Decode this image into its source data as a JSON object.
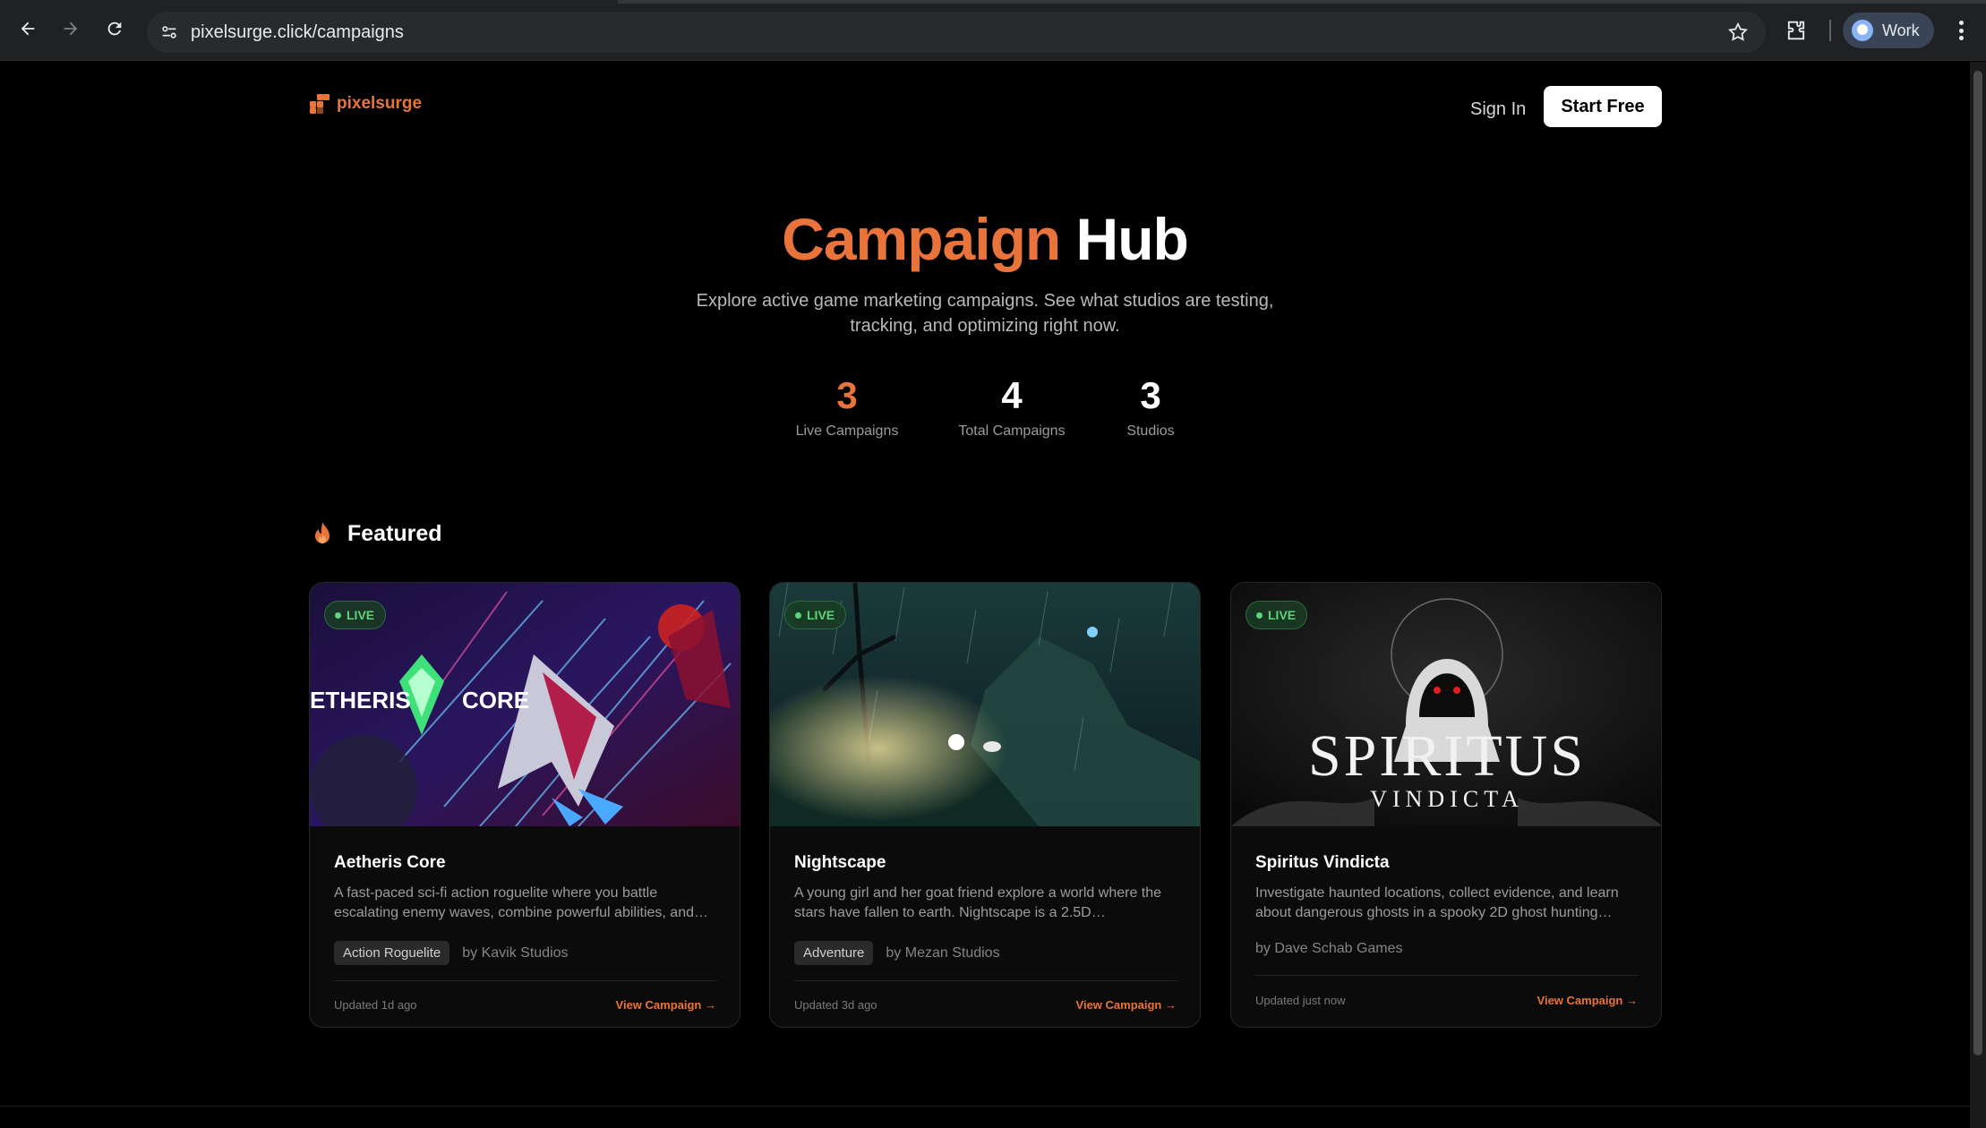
{
  "browser": {
    "url": "pixelsurge.click/campaigns",
    "profile_label": "Work"
  },
  "header": {
    "logo_text": "pixelsurge",
    "sign_in": "Sign In",
    "start_free": "Start Free"
  },
  "hero": {
    "title_accent": "Campaign",
    "title_rest": "Hub",
    "subtitle": "Explore active game marketing campaigns. See what studios are testing, tracking, and optimizing right now."
  },
  "stats": [
    {
      "value": "3",
      "label": "Live Campaigns"
    },
    {
      "value": "4",
      "label": "Total Campaigns"
    },
    {
      "value": "3",
      "label": "Studios"
    }
  ],
  "featured": {
    "heading": "Featured",
    "cards": [
      {
        "badge": "LIVE",
        "image_text": "ETHERIS CORE",
        "title": "Aetheris Core",
        "description": "A fast-paced sci-fi action roguelite where you battle escalating enemy waves, combine powerful abilities, and…",
        "tag": "Action Roguelite",
        "studio": "by Kavik Studios",
        "updated": "Updated 1d ago",
        "view": "View Campaign →"
      },
      {
        "badge": "LIVE",
        "title": "Nightscape",
        "description": "A young girl and her goat friend explore a world where the stars have fallen to earth. Nightscape is a 2.5D…",
        "tag": "Adventure",
        "studio": "by Mezan Studios",
        "updated": "Updated 3d ago",
        "view": "View Campaign →"
      },
      {
        "badge": "LIVE",
        "image_title": "SPIRITUS",
        "image_subtitle": "VINDICTA",
        "title": "Spiritus Vindicta",
        "description": "Investigate haunted locations, collect evidence, and learn about dangerous ghosts in a spooky 2D ghost hunting…",
        "studio": "by Dave Schab Games",
        "updated": "Updated just now",
        "view": "View Campaign →"
      }
    ]
  },
  "colors": {
    "accent": "#e8743b",
    "live_green": "#5fd37a",
    "background": "#000000"
  }
}
